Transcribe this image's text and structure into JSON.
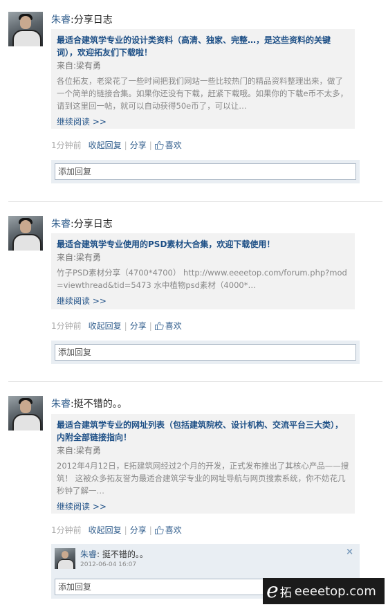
{
  "feed": [
    {
      "author": "朱睿",
      "action": ":分享日志",
      "title": "最适合建筑学专业的设计类资料（高清、独家、完整…，是这些资料的关键词），欢迎拓友们下载啦！",
      "source_label": "来自:",
      "source_name": "梁有勇",
      "excerpt": "各位拓友，老梁花了一些时间把我们网站一些比较热门的精品资料整理出来，做了一个简单的链接合集。如果你还没有下载，赶紧下载哦。如果你的下载e币不太多，请到这里回一帖，就可以自动获得50e币了，可以让…",
      "readmore": "继续阅读 >>",
      "time": "1分钟前",
      "collapse_reply": "收起回复",
      "share": "分享",
      "like": "喜欢",
      "reply_placeholder": "添加回复"
    },
    {
      "author": "朱睿",
      "action": ":分享日志",
      "title": "最适合建筑学专业使用的PSD素材大合集，欢迎下载使用！",
      "source_label": "来自:",
      "source_name": "梁有勇",
      "excerpt": "竹子PSD素材分享（4700*4700） http://www.eeeetop.com/forum.php?mod=viewthread&tid=5473 水中植物psd素材（4000*…",
      "readmore": "继续阅读 >>",
      "time": "1分钟前",
      "collapse_reply": "收起回复",
      "share": "分享",
      "like": "喜欢",
      "reply_placeholder": "添加回复"
    },
    {
      "author": "朱睿",
      "action": ":挺不错的。。",
      "title": "最适合建筑学专业的网址列表（包括建筑院校、设计机构、交流平台三大类），内附全部链接指向！",
      "source_label": "来自:",
      "source_name": "梁有勇",
      "excerpt": "2012年4月12日，E拓建筑网经过2个月的开发，正式发布推出了其核心产品——搜筑！ 这被众多拓友誉为最适合建筑学专业的网址导航与网页搜索系统，你不妨花几秒钟了解一…",
      "readmore": "继续阅读 >>",
      "time": "1分钟前",
      "collapse_reply": "收起回复",
      "share": "分享",
      "like": "喜欢",
      "reply_placeholder": "添加回复",
      "comment": {
        "author": "朱睿",
        "text": ": 挺不错的。。",
        "time": "2012-06-04 16:07",
        "close": "×"
      }
    }
  ],
  "watermark": {
    "logo_e": "e",
    "logo_cn": "拓",
    "domain": "eeeetop.com"
  }
}
